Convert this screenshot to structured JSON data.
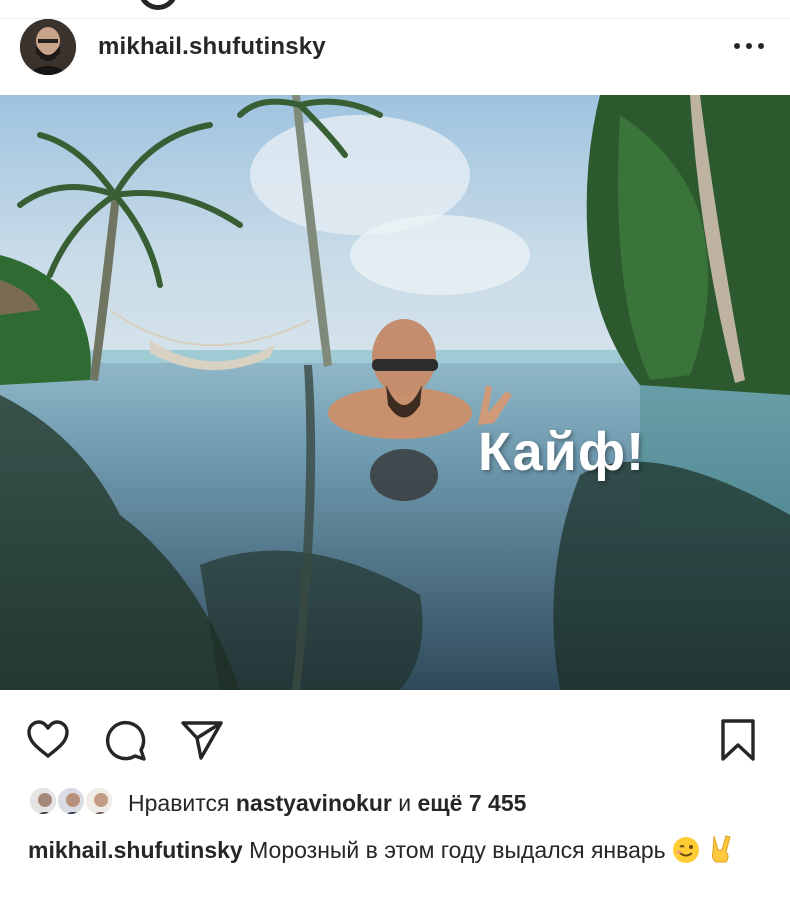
{
  "post": {
    "username": "mikhail.shufutinsky",
    "more_icon": "ellipsis-horizontal-icon",
    "image": {
      "overlay_text": "Кайф!",
      "description_icon": "photo-content"
    }
  },
  "actions": {
    "like_icon": "heart-outline-icon",
    "comment_icon": "comment-bubble-icon",
    "share_icon": "paper-plane-icon",
    "save_icon": "bookmark-outline-icon"
  },
  "likes": {
    "prefix": "Нравится",
    "user": "nastyavinokur",
    "middle": "и",
    "more": "ещё 7 455"
  },
  "caption": {
    "username": "mikhail.shufutinsky",
    "text": "Морозный в этом году выдался январь",
    "emojis": [
      "winking-face-emoji",
      "victory-hand-emoji"
    ]
  },
  "colors": {
    "text": "#262626",
    "divider": "#efefef",
    "overlay_text": "#ffffff"
  }
}
